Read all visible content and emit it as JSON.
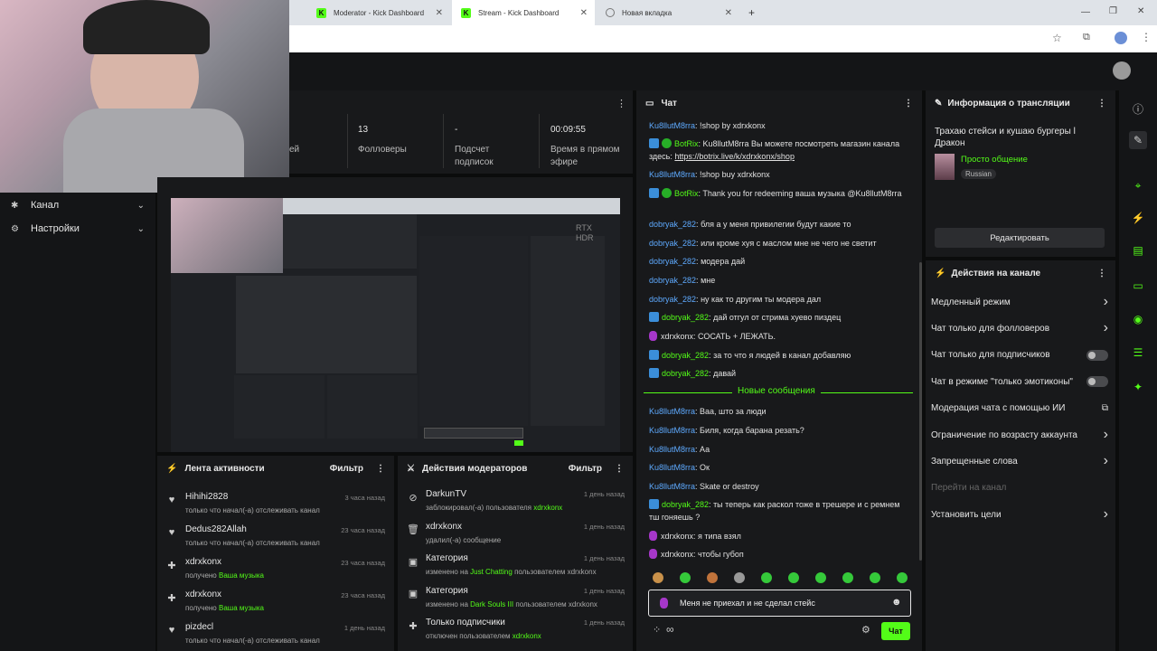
{
  "browser": {
    "tabs": [
      {
        "label": "Moderator - Kick Dashboard",
        "logo": "K"
      },
      {
        "label": "Stream - Kick Dashboard",
        "logo": "K"
      },
      {
        "label": "Новая вкладка",
        "logo": ""
      }
    ],
    "new_tab": "+"
  },
  "sidebar": {
    "items": [
      {
        "label": "Канал",
        "icon": "star-icon"
      },
      {
        "label": "Настройки",
        "icon": "gear-icon"
      }
    ]
  },
  "stats": {
    "partial_label": "ей",
    "followers_value": "13",
    "followers_label": "Фолловеры",
    "subs_value": "-",
    "subs_label_1": "Подсчет",
    "subs_label_2": "подписок",
    "time_value": "00:09:55",
    "time_label_1": "Время в прямом",
    "time_label_2": "эфире"
  },
  "preview": {
    "rtx_1": "RTX",
    "rtx_2": "HDR"
  },
  "activity": {
    "title": "Лента активности",
    "filter": "Фильтр",
    "items": [
      {
        "user": "Hihihi2828",
        "text": "только что начал(-а) отслеживать канал",
        "time": "3 часа назад",
        "icon": "heart",
        "highlight": ""
      },
      {
        "user": "Dedus282Allah",
        "text": "только что начал(-а) отслеживать канал",
        "time": "23 часа назад",
        "icon": "heart",
        "highlight": ""
      },
      {
        "user": "xdrxkonx",
        "text": "получено ",
        "time": "23 часа назад",
        "icon": "gift",
        "highlight": "Ваша музыка"
      },
      {
        "user": "xdrxkonx",
        "text": "получено ",
        "time": "23 часа назад",
        "icon": "gift",
        "highlight": "Ваша музыка"
      },
      {
        "user": "pizdecl",
        "text": "только что начал(-а) отслеживать канал",
        "time": "1 день назад",
        "icon": "heart",
        "highlight": ""
      }
    ]
  },
  "modactions": {
    "title": "Действия модераторов",
    "filter": "Фильтр",
    "items": [
      {
        "title": "DarkunTV",
        "pre": "заблокировал(-а) пользователя ",
        "hl": "xdrxkonx",
        "post": "",
        "time": "1 день назад",
        "icon": "ban"
      },
      {
        "title": "xdrxkonx",
        "pre": "удалил(-а) сообщение",
        "hl": "",
        "post": "",
        "time": "1 день назад",
        "icon": "trash"
      },
      {
        "title": "Категория",
        "pre": "изменено на ",
        "hl": "Just Chatting",
        "post": " пользователем xdrxkonx",
        "time": "1 день назад",
        "icon": "category"
      },
      {
        "title": "Категория",
        "pre": "изменено на ",
        "hl": "Dark Souls III",
        "post": " пользователем xdrxkonx",
        "time": "1 день назад",
        "icon": "category"
      },
      {
        "title": "Только подписчики",
        "pre": "отключен пользователем ",
        "hl": "xdrxkonx",
        "post": "",
        "time": "1 день назад",
        "icon": "gift"
      }
    ]
  },
  "chat": {
    "title": "Чат",
    "messages": [
      {
        "badge": "",
        "user": "Ku8llutM8rra",
        "text": "!shop by xdrxkonx"
      },
      {
        "badge": "bot",
        "user": "BotRix",
        "text": "Ku8llutM8rra Вы можете посмотреть магазин канала здесь: https://botrix.live/k/xdrxkonx/shop"
      },
      {
        "badge": "",
        "user": "Ku8llutM8rra",
        "text": "!shop buy xdrxkonx"
      },
      {
        "badge": "bot",
        "user": "BotRix",
        "text": "Thank you for redeeming ваша музыка @Ku8llutM8rra"
      },
      {
        "badge": "",
        "user": "dobryak_282",
        "text": "бля а у меня привилегии будут какие то"
      },
      {
        "badge": "",
        "user": "dobryak_282",
        "text": "или кроме хуя с маслом мне не чего не светит"
      },
      {
        "badge": "",
        "user": "dobryak_282",
        "text": "модера дай"
      },
      {
        "badge": "",
        "user": "dobryak_282",
        "text": "мне"
      },
      {
        "badge": "",
        "user": "dobryak_282",
        "text": "ну как то другим ты модера дал"
      },
      {
        "badge": "mod",
        "user": "dobryak_282",
        "text": "дай отгул от стрима хуево пиздец"
      },
      {
        "badge": "host",
        "user": "xdrxkonx",
        "text": "СОСАТЬ + ЛЕЖАТЬ."
      },
      {
        "badge": "mod",
        "user": "dobryak_282",
        "text": "за то что я людей в канал добавляю"
      },
      {
        "badge": "mod",
        "user": "dobryak_282",
        "text": "давай"
      }
    ],
    "divider": "Новые сообщения",
    "new_messages": [
      {
        "badge": "",
        "user": "Ku8llutM8rra",
        "text": "Ваа, што за люди"
      },
      {
        "badge": "",
        "user": "Ku8llutM8rra",
        "text": "Биля, когда барана резать?"
      },
      {
        "badge": "",
        "user": "Ku8llutM8rra",
        "text": "Аа"
      },
      {
        "badge": "",
        "user": "Ku8llutM8rra",
        "text": "Ок"
      },
      {
        "badge": "",
        "user": "Ku8llutM8rra",
        "text": "Skate or destroy"
      },
      {
        "badge": "mod",
        "user": "dobryak_282",
        "text": "ты теперь как раскол тоже в трешере и с ремнем тш гоняешь ?"
      },
      {
        "badge": "host",
        "user": "xdrxkonx",
        "text": "я типа взял"
      },
      {
        "badge": "host",
        "user": "xdrxkonx",
        "text": "чтобы губоп"
      }
    ],
    "input_value": "Меня не приехал и не сделал стейс",
    "send_label": "Чат",
    "infinity": "∞"
  },
  "stream_info": {
    "title": "Информация о трансляции",
    "stream_title": "Трахаю стейси и кушаю бургеры l Дракон",
    "category": "Просто общение",
    "language": "Russian",
    "edit_label": "Редактировать"
  },
  "channel_actions": {
    "title": "Действия на канале",
    "items": [
      {
        "label": "Медленный режим",
        "control": "chevron"
      },
      {
        "label": "Чат только для фолловеров",
        "control": "chevron"
      },
      {
        "label": "Чат только для подписчиков",
        "control": "toggle"
      },
      {
        "label": "Чат в режиме \"только эмотиконы\"",
        "control": "toggle"
      },
      {
        "label": "Модерация чата с помощью ИИ",
        "control": "external"
      },
      {
        "label": "Ограничение по возрасту аккаунта",
        "control": "chevron"
      },
      {
        "label": "Запрещенные слова",
        "control": "chevron"
      },
      {
        "label": "Перейти на канал",
        "control": "none",
        "disabled": true
      },
      {
        "label": "Установить цели",
        "control": "chevron"
      }
    ]
  },
  "colors": {
    "accent": "#53fc18",
    "panel": "#18191b",
    "bg": "#0b0c0c"
  }
}
